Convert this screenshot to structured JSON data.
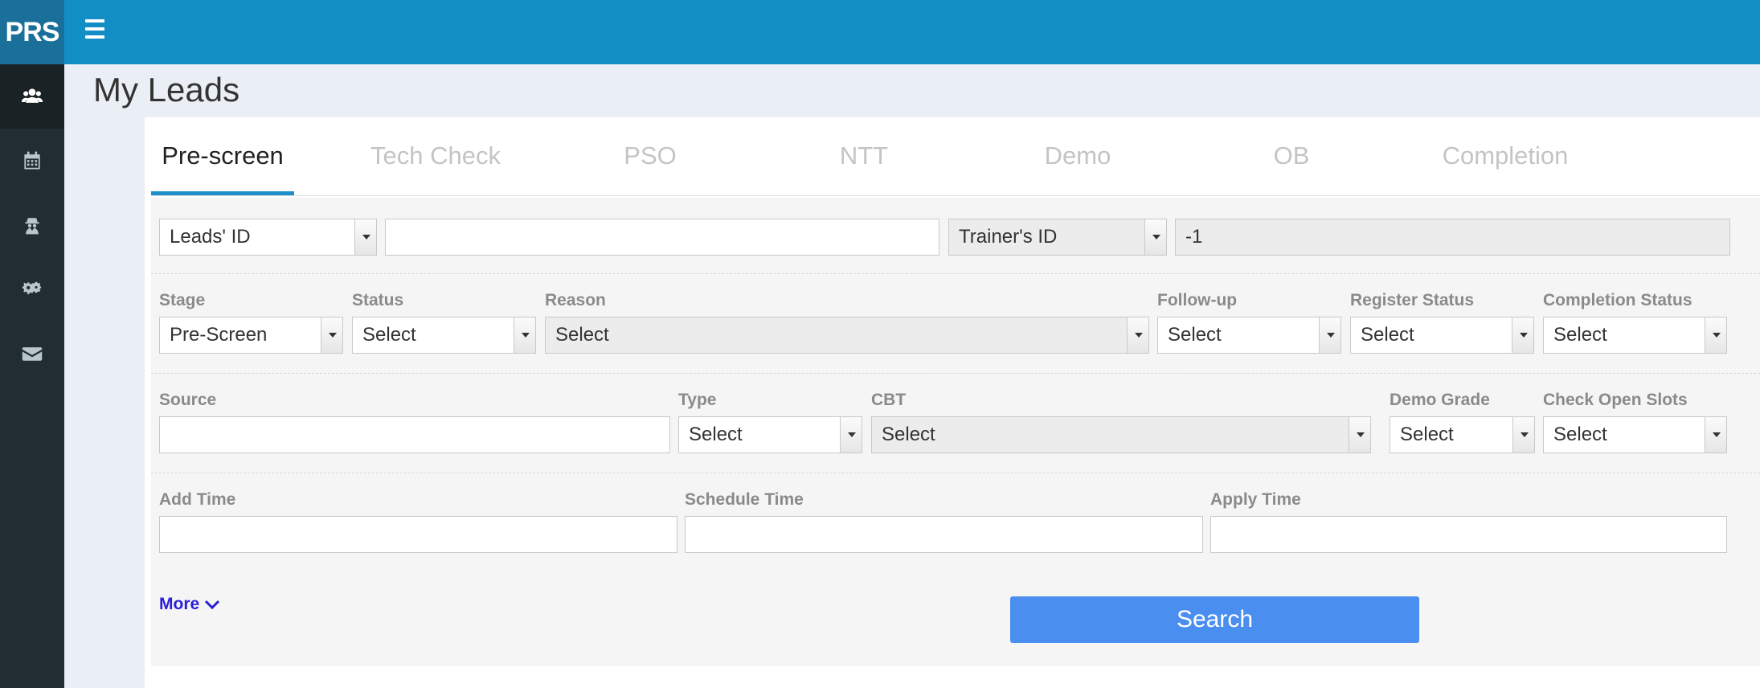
{
  "app": {
    "logo": "PRS",
    "menu_icon": "hamburger-icon"
  },
  "sidebar": {
    "items": [
      {
        "icon": "users-icon",
        "active": true
      },
      {
        "icon": "calendar-icon",
        "active": false
      },
      {
        "icon": "user-secret-icon",
        "active": false
      },
      {
        "icon": "gears-icon",
        "active": false
      },
      {
        "icon": "envelope-icon",
        "active": false
      }
    ]
  },
  "page": {
    "title": "My Leads"
  },
  "tabs": [
    {
      "label": "Pre-screen",
      "active": true
    },
    {
      "label": "Tech Check",
      "active": false
    },
    {
      "label": "PSO",
      "active": false
    },
    {
      "label": "NTT",
      "active": false
    },
    {
      "label": "Demo",
      "active": false
    },
    {
      "label": "OB",
      "active": false
    },
    {
      "label": "Completion",
      "active": false
    }
  ],
  "filters": {
    "row1": {
      "id_type_value": "Leads' ID",
      "id_input_value": "",
      "trainer_id_label": "Trainer's ID",
      "trainer_id_value": "-1"
    },
    "row2": {
      "stage": {
        "label": "Stage",
        "value": "Pre-Screen"
      },
      "status": {
        "label": "Status",
        "value": "Select"
      },
      "reason": {
        "label": "Reason",
        "value": "Select"
      },
      "follow_up": {
        "label": "Follow-up",
        "value": "Select"
      },
      "register_status": {
        "label": "Register Status",
        "value": "Select"
      },
      "completion_status": {
        "label": "Completion Status",
        "value": "Select"
      }
    },
    "row3": {
      "source": {
        "label": "Source",
        "value": ""
      },
      "type": {
        "label": "Type",
        "value": "Select"
      },
      "cbt": {
        "label": "CBT",
        "value": "Select"
      },
      "demo_grade": {
        "label": "Demo Grade",
        "value": "Select"
      },
      "check_open_slots": {
        "label": "Check Open Slots",
        "value": "Select"
      }
    },
    "row4": {
      "add_time": {
        "label": "Add Time",
        "value": ""
      },
      "schedule_time": {
        "label": "Schedule Time",
        "value": ""
      },
      "apply_time": {
        "label": "Apply Time",
        "value": ""
      }
    },
    "more_label": "More",
    "search_label": "Search"
  },
  "colors": {
    "topbar": "#138ec5",
    "sidebar": "#222d32",
    "accent_tab": "#1e8fcb",
    "search_button": "#4a8ef0",
    "more_link": "#2a1fd6"
  }
}
